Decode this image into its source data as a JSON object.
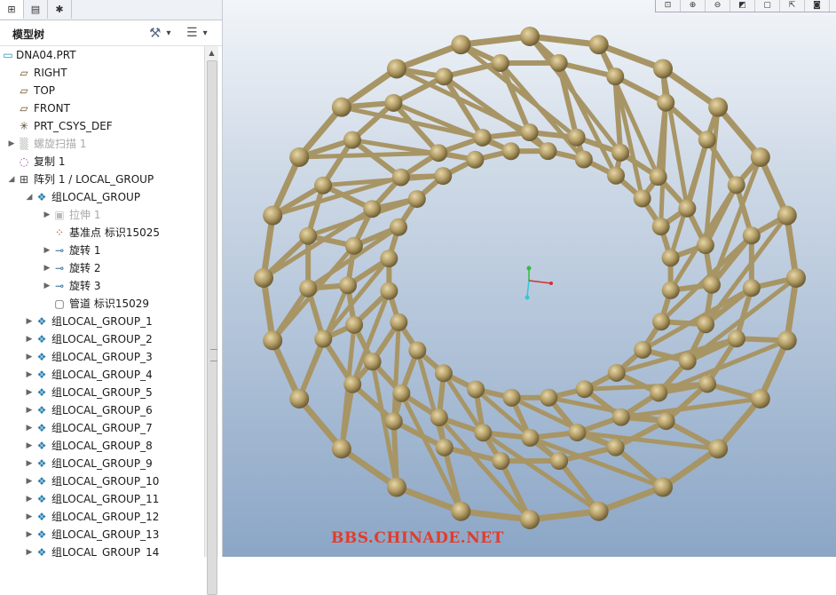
{
  "tabs": [
    {
      "icon": "model-tree-tab-icon",
      "glyph": "⊞"
    },
    {
      "icon": "layers-tab-icon",
      "glyph": "▤"
    },
    {
      "icon": "favorites-tab-icon",
      "glyph": "✱"
    }
  ],
  "tree_header": {
    "title": "模型树",
    "settings_glyph": "⚒",
    "show_glyph": "☰",
    "dropdown_glyph": "▾"
  },
  "tree": {
    "items": [
      {
        "label": "DNA04.PRT",
        "icon": "part-icon",
        "expander": ""
      },
      {
        "label": "RIGHT",
        "icon": "datum-plane-icon",
        "expander": ""
      },
      {
        "label": "TOP",
        "icon": "datum-plane-icon",
        "expander": ""
      },
      {
        "label": "FRONT",
        "icon": "datum-plane-icon",
        "expander": ""
      },
      {
        "label": "PRT_CSYS_DEF",
        "icon": "coordinate-system-icon",
        "expander": ""
      },
      {
        "label": "螺旋扫描 1",
        "icon": "helical-sweep-icon",
        "expander": "▶",
        "dim": true
      },
      {
        "label": "复制 1",
        "icon": "copy-icon",
        "expander": ""
      },
      {
        "label": "阵列 1 / LOCAL_GROUP",
        "icon": "pattern-icon",
        "expander": "◢"
      },
      {
        "label": "组LOCAL_GROUP",
        "icon": "group-icon",
        "expander": "◢"
      },
      {
        "label": "拉伸 1",
        "icon": "extrude-icon",
        "expander": "▶",
        "dim": true
      },
      {
        "label": "基准点 标识15025",
        "icon": "datum-point-icon",
        "expander": ""
      },
      {
        "label": "旋转 1",
        "icon": "revolve-icon",
        "expander": "▶"
      },
      {
        "label": "旋转 2",
        "icon": "revolve-icon",
        "expander": "▶"
      },
      {
        "label": "旋转 3",
        "icon": "revolve-icon",
        "expander": "▶"
      },
      {
        "label": "管道 标识15029",
        "icon": "pipe-icon",
        "expander": ""
      },
      {
        "label": "组LOCAL_GROUP_1",
        "icon": "group-icon",
        "expander": "▶"
      },
      {
        "label": "组LOCAL_GROUP_2",
        "icon": "group-icon",
        "expander": "▶"
      },
      {
        "label": "组LOCAL_GROUP_3",
        "icon": "group-icon",
        "expander": "▶"
      },
      {
        "label": "组LOCAL_GROUP_4",
        "icon": "group-icon",
        "expander": "▶"
      },
      {
        "label": "组LOCAL_GROUP_5",
        "icon": "group-icon",
        "expander": "▶"
      },
      {
        "label": "组LOCAL_GROUP_6",
        "icon": "group-icon",
        "expander": "▶"
      },
      {
        "label": "组LOCAL_GROUP_7",
        "icon": "group-icon",
        "expander": "▶"
      },
      {
        "label": "组LOCAL_GROUP_8",
        "icon": "group-icon",
        "expander": "▶"
      },
      {
        "label": "组LOCAL_GROUP_9",
        "icon": "group-icon",
        "expander": "▶"
      },
      {
        "label": "组LOCAL_GROUP_10",
        "icon": "group-icon",
        "expander": "▶"
      },
      {
        "label": "组LOCAL_GROUP_11",
        "icon": "group-icon",
        "expander": "▶"
      },
      {
        "label": "组LOCAL_GROUP_12",
        "icon": "group-icon",
        "expander": "▶"
      },
      {
        "label": "组LOCAL_GROUP_13",
        "icon": "group-icon",
        "expander": "▶"
      },
      {
        "label": "组LOCAL_GROUP_14",
        "icon": "group-icon",
        "expander": "▶"
      }
    ]
  },
  "view_toolbar": [
    {
      "icon": "refit-icon",
      "glyph": "⊡"
    },
    {
      "icon": "zoom-in-icon",
      "glyph": "⊕"
    },
    {
      "icon": "zoom-out-icon",
      "glyph": "⊖"
    },
    {
      "icon": "repaint-icon",
      "glyph": "◩"
    },
    {
      "icon": "display-style-icon",
      "glyph": "▢"
    },
    {
      "icon": "saved-orientations-icon",
      "glyph": "⇱"
    },
    {
      "icon": "screenshot-icon",
      "glyph": "◙"
    }
  ],
  "model": {
    "strut_color": "#a89565",
    "node_color": "#b39d66"
  },
  "watermark": "BBS.CHINADE.NET"
}
